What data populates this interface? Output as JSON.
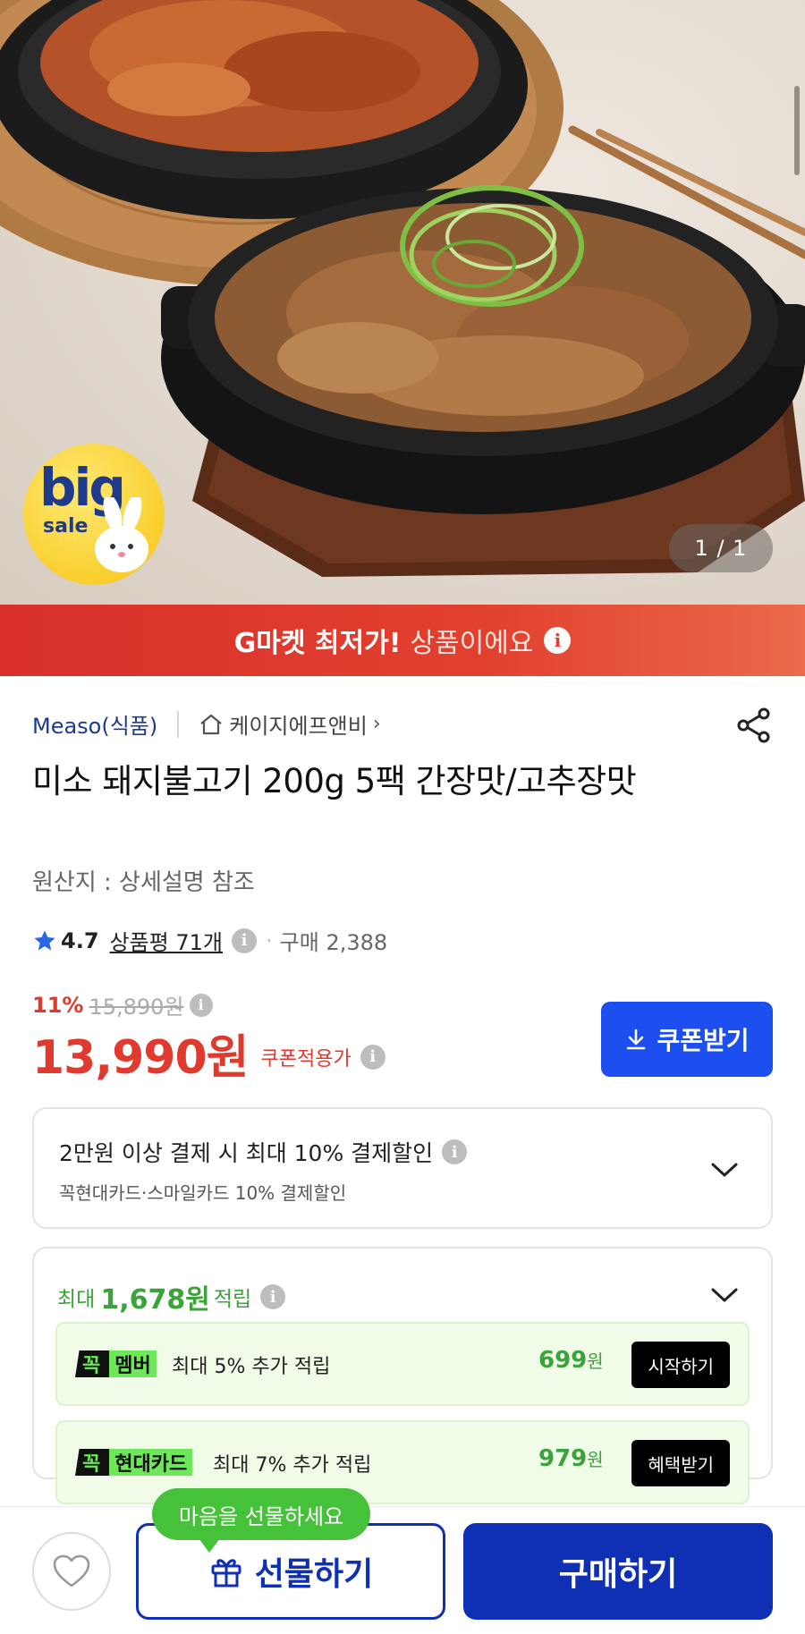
{
  "hero": {
    "counter": "1 / 1",
    "badge": {
      "line1": "big",
      "line2": "sale"
    }
  },
  "banner": {
    "strong": "G마켓 최저가!",
    "light": "상품이에요",
    "info_icon": "i"
  },
  "product": {
    "brand": "Measo(식품)",
    "store": "케이지에프앤비",
    "store_chevron": "›",
    "title": "미소 돼지불고기 200g 5팩 간장맛/고추장맛",
    "origin": "원산지 : 상세설명 참조",
    "rating": "4.7",
    "reviews": "상품평 71개",
    "purchases": "구매 2,388",
    "discount_pct": "11%",
    "original_price": "15,890원",
    "price": "13,990원",
    "price_note": "쿠폰적용가",
    "coupon_button": "쿠폰받기"
  },
  "payment_discount": {
    "title": "2만원 이상 결제 시 최대 10% 결제할인",
    "subtitle": "꼭현대카드·스마일카드 10% 결제할인"
  },
  "points": {
    "prefix": "최대",
    "amount": "1,678원",
    "suffix": "적립",
    "rows": [
      {
        "tag_prefix": "꼭",
        "tag_name": "멤버",
        "text": "최대 5% 추가 적립",
        "amount": "699",
        "unit": "원",
        "button": "시작하기"
      },
      {
        "tag_prefix": "꼭",
        "tag_name": "현대카드",
        "text": "최대 7% 추가 적립",
        "amount": "979",
        "unit": "원",
        "button": "혜택받기"
      }
    ]
  },
  "bottom_bar": {
    "tooltip": "마음을 선물하세요",
    "gift_button": "선물하기",
    "buy_button": "구매하기"
  },
  "colors": {
    "brand_blue": "#1d3a8f",
    "price_red": "#e0392e",
    "coupon_blue": "#1c4ef0",
    "buy_navy": "#0f2fb5",
    "points_green": "#3aa33a",
    "tooltip_green": "#45c23a",
    "tag_lime": "#6ee85a"
  },
  "icons": [
    "info-icon",
    "home-icon",
    "share-icon",
    "star-icon",
    "download-icon",
    "chevron-down-icon",
    "heart-icon",
    "gift-icon"
  ]
}
